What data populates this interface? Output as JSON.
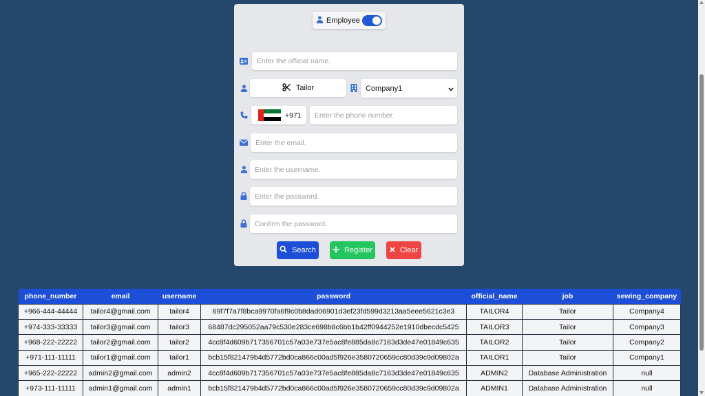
{
  "toggle": {
    "label": "Employee",
    "state": "on"
  },
  "form": {
    "official_name_placeholder": "Enter the official name.",
    "job_label": "Tailor",
    "company_selected": "Company1",
    "phone_country_code": "+971",
    "phone_placeholder": "Enter the phone number.",
    "email_placeholder": "Enter the email.",
    "username_placeholder": "Enter the username.",
    "password_placeholder": "Enter the password.",
    "confirm_password_placeholder": "Confirm the password."
  },
  "buttons": {
    "search": "Search",
    "register": "Register",
    "clear": "Clear"
  },
  "colors": {
    "primary": "#1d4ed8",
    "success": "#22c55e",
    "danger": "#ef4444",
    "background": "#24476b"
  },
  "table": {
    "headers": [
      "phone_number",
      "email",
      "username",
      "password",
      "official_name",
      "job",
      "sewing_company"
    ],
    "rows": [
      [
        "+966-444-44444",
        "tailor4@gmail.com",
        "tailor4",
        "69f7f7a7f8bca9970fa6f9c0b8dad06901d3ef23fd599d3213aa5eee5621c3e3",
        "TAILOR4",
        "Tailor",
        "Company4"
      ],
      [
        "+974-333-33333",
        "tailor3@gmail.com",
        "tailor3",
        "68487dc295052aa79c530e283ce698b8c6bb1b42ff0944252e1910dbecdc5425",
        "TAILOR3",
        "Tailor",
        "Company3"
      ],
      [
        "+968-222-22222",
        "tailor2@gmail.com",
        "tailor2",
        "4cc8f4d609b717356701c57a03e737e5ac8fe885da8c7163d3de47e01849c635",
        "TAILOR2",
        "Tailor",
        "Company2"
      ],
      [
        "+971-111-11111",
        "tailor1@gmail.com",
        "tailor1",
        "bcb15f821479b4d5772bd0ca866c00ad5f926e3580720659cc80d39c9d09802a",
        "TAILOR1",
        "Tailor",
        "Company1"
      ],
      [
        "+965-222-22222",
        "admin2@gmail.com",
        "admin2",
        "4cc8f4d609b717356701c57a03e737e5ac8fe885da8c7163d3de47e01849c635",
        "ADMIN2",
        "Database Administration",
        "null"
      ],
      [
        "+973-111-11111",
        "admin1@gmail.com",
        "admin1",
        "bcb15f821479b4d5772bd0ca866c00ad5f926e3580720659cc80d39c9d09802a",
        "ADMIN1",
        "Database Administration",
        "null"
      ]
    ]
  }
}
